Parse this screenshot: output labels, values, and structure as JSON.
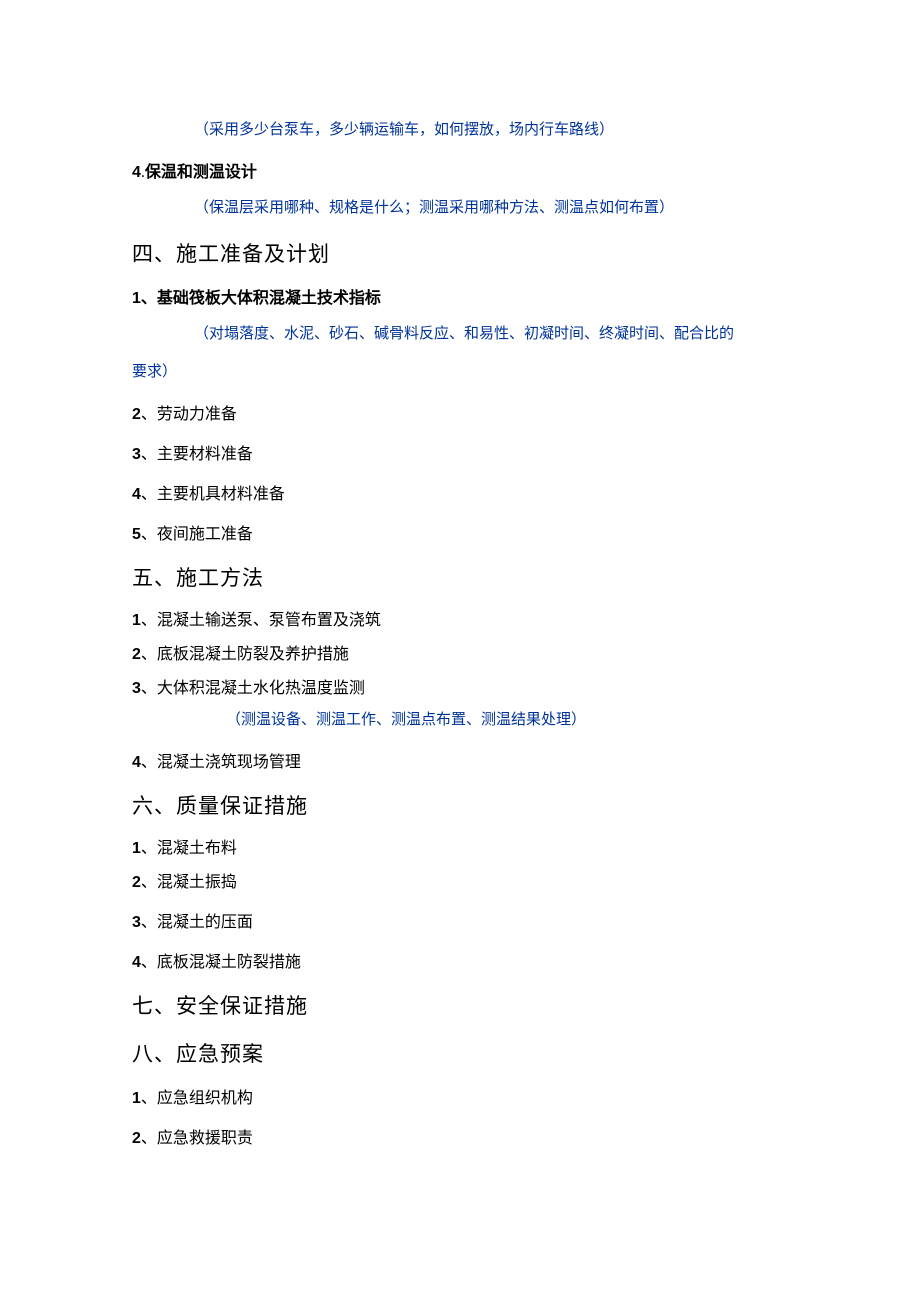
{
  "notes": {
    "n1": "（采用多少台泵车，多少辆运输车，如何摆放，场内行车路线）",
    "n2": "（保温层采用哪种、规格是什么；测温采用哪种方法、测温点如何布置）",
    "n3a": "（对塌落度、水泥、砂石、碱骨料反应、和易性、初凝时间、终凝时间、配合比的",
    "n3b": "要求）",
    "n4": "（测温设备、测温工作、测温点布置、测温结果处理）"
  },
  "items": {
    "s3_4_num": "4",
    "s3_4_dot": ".",
    "s3_4": "保温和测温设计",
    "s4_title": "四、施工准备及计划",
    "s4_1_num": "1",
    "s4_1": "、基础筏板大体积混凝土技术指标",
    "s4_2_num": "2",
    "s4_2": "、劳动力准备",
    "s4_3_num": "3",
    "s4_3": "、主要材料准备",
    "s4_4_num": "4",
    "s4_4": "、主要机具材料准备",
    "s4_5_num": "5",
    "s4_5": "、夜间施工准备",
    "s5_title": "五、施工方法",
    "s5_1_num": "1",
    "s5_1": "、混凝土输送泵、泵管布置及浇筑",
    "s5_2_num": "2",
    "s5_2": "、底板混凝土防裂及养护措施",
    "s5_3_num": "3",
    "s5_3": "、大体积混凝土水化热温度监测",
    "s5_4_num": "4",
    "s5_4": "、混凝土浇筑现场管理",
    "s6_title": "六、质量保证措施",
    "s6_1_num": "1",
    "s6_1": "、混凝土布料",
    "s6_2_num": "2",
    "s6_2": "、混凝土振捣",
    "s6_3_num": "3",
    "s6_3": "、混凝土的压面",
    "s6_4_num": "4",
    "s6_4": "、底板混凝土防裂措施",
    "s7_title": "七、安全保证措施",
    "s8_title": "八、应急预案",
    "s8_1_num": "1",
    "s8_1": "、应急组织机构",
    "s8_2_num": "2",
    "s8_2": "、应急救援职责"
  }
}
